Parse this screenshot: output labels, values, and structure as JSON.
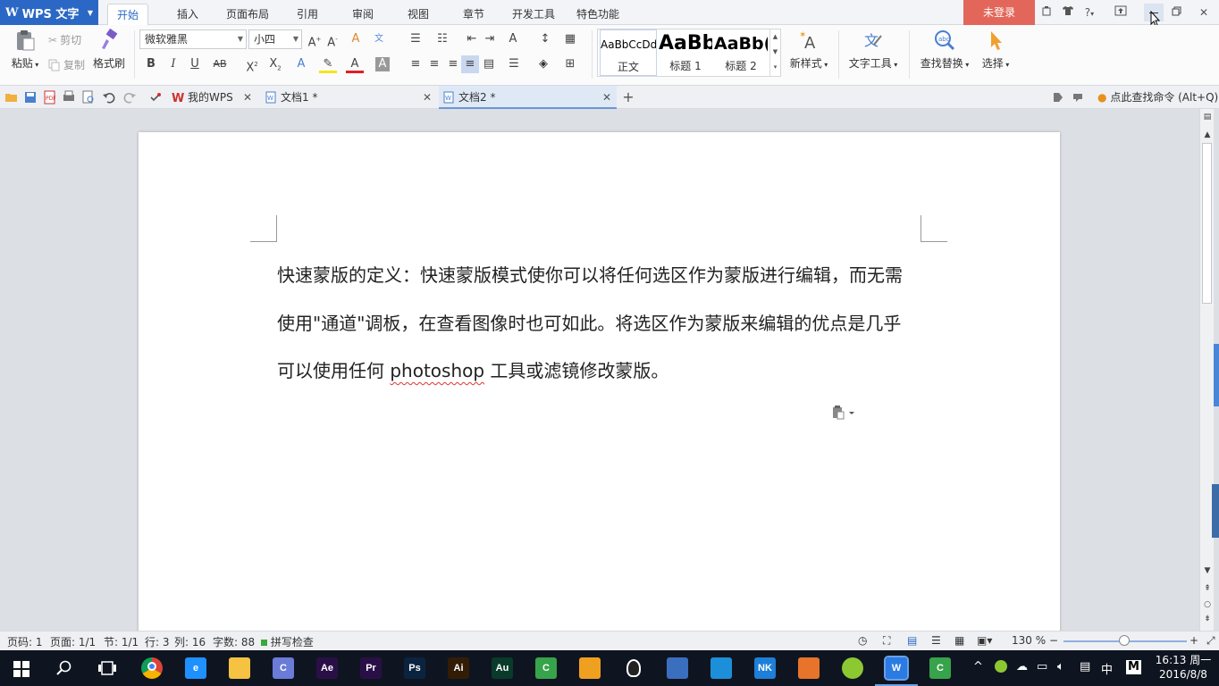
{
  "app": {
    "menu_label": "WPS 文字",
    "logo": "W"
  },
  "menu_tabs": [
    "开始",
    "插入",
    "页面布局",
    "引用",
    "审阅",
    "视图",
    "章节",
    "开发工具",
    "特色功能"
  ],
  "login": "未登录",
  "help": "?",
  "ribbon": {
    "paste": "粘贴",
    "cut": "剪切",
    "copy": "复制",
    "format_painter": "格式刷",
    "font_name": "微软雅黑",
    "font_size": "小四",
    "styles": [
      {
        "preview": "AaBbCcDd",
        "name": "正文"
      },
      {
        "preview": "AaBb",
        "name": "标题 1"
      },
      {
        "preview": "AaBb(",
        "name": "标题 2"
      }
    ],
    "new_style": "新样式",
    "text_tools": "文字工具",
    "find_replace": "查找替换",
    "select": "选择"
  },
  "tabs": [
    {
      "label": "我的WPS",
      "active": false
    },
    {
      "label": "文档1 *",
      "active": false
    },
    {
      "label": "文档2 *",
      "active": true
    }
  ],
  "find_command": "点此查找命令 (Alt+Q)",
  "document": {
    "line1": "快速蒙版的定义：快速蒙版模式使你可以将任何选区作为蒙版进行编辑，而无需",
    "line2": "使用\"通道\"调板，在查看图像时也可如此。将选区作为蒙版来编辑的优点是几乎",
    "line3_before": "可以使用任何 ",
    "line3_word": "photoshop",
    "line3_after": " 工具或滤镜修改蒙版。"
  },
  "status": {
    "page_code": "页码: 1",
    "page": "页面: 1/1",
    "section": "节: 1/1",
    "row": "行: 3",
    "col": "列: 16",
    "word_count": "字数: 88",
    "spell_check": "拼写检查",
    "zoom": "130 %",
    "zoom_fraction": 0.49
  },
  "taskbar": {
    "apps": [
      {
        "label": "",
        "color": "#ffffff",
        "icon": "chrome-icon"
      },
      {
        "label": "e",
        "color": "#1e90ff",
        "icon": "edge-icon"
      },
      {
        "label": "",
        "color": "#f5c242",
        "icon": "folder-icon"
      },
      {
        "label": "C",
        "color": "#6a7bd8",
        "icon": "c4d-icon"
      },
      {
        "label": "Ae",
        "color": "#2a0f47",
        "icon": "ae-icon"
      },
      {
        "label": "Pr",
        "color": "#2a0f47",
        "icon": "pr-icon"
      },
      {
        "label": "Ps",
        "color": "#0a2440",
        "icon": "ps-icon"
      },
      {
        "label": "Ai",
        "color": "#331c05",
        "icon": "ai-icon"
      },
      {
        "label": "Au",
        "color": "#0a3a2a",
        "icon": "au-icon"
      },
      {
        "label": "C",
        "color": "#37a34a",
        "icon": "camtasia-icon"
      },
      {
        "label": "",
        "color": "#f0a020",
        "icon": "fl-icon"
      },
      {
        "label": "",
        "color": "#222222",
        "icon": "qq-icon"
      },
      {
        "label": "",
        "color": "#3a6fc0",
        "icon": "film-icon"
      },
      {
        "label": "",
        "color": "#1d8fd8",
        "icon": "bird-icon"
      },
      {
        "label": "NK",
        "color": "#1d7fd8",
        "icon": "nk-icon"
      },
      {
        "label": "",
        "color": "#e8732a",
        "icon": "feather-icon"
      },
      {
        "label": "",
        "color": "#8cc832",
        "icon": "circle-app-icon"
      },
      {
        "label": "W",
        "color": "#2b7be4",
        "icon": "wps-icon"
      },
      {
        "label": "C",
        "color": "#37a34a",
        "icon": "camtasia2-icon"
      }
    ],
    "ime": "中",
    "ime2": "M",
    "time": "16:13 周一",
    "date": "2016/8/8"
  }
}
